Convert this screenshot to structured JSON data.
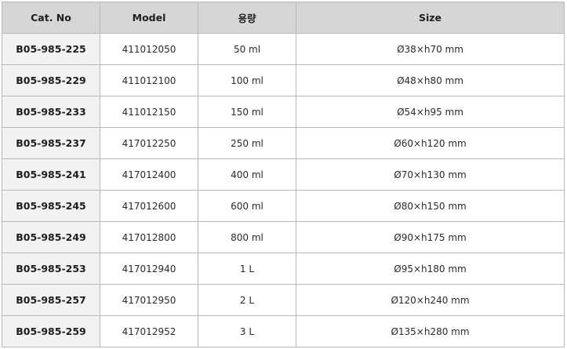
{
  "table": {
    "headers": [
      "Cat. No",
      "Model",
      "용량",
      "Size"
    ],
    "rows": [
      {
        "cat": "B05-985-225",
        "model": "411012050",
        "volume": "50 ml",
        "size": "Ø38×h70 mm"
      },
      {
        "cat": "B05-985-229",
        "model": "411012100",
        "volume": "100 ml",
        "size": "Ø48×h80 mm"
      },
      {
        "cat": "B05-985-233",
        "model": "411012150",
        "volume": "150 ml",
        "size": "Ø54×h95 mm"
      },
      {
        "cat": "B05-985-237",
        "model": "417012250",
        "volume": "250 ml",
        "size": "Ø60×h120 mm"
      },
      {
        "cat": "B05-985-241",
        "model": "417012400",
        "volume": "400 ml",
        "size": "Ø70×h130 mm"
      },
      {
        "cat": "B05-985-245",
        "model": "417012600",
        "volume": "600 ml",
        "size": "Ø80×h150 mm"
      },
      {
        "cat": "B05-985-249",
        "model": "417012800",
        "volume": "800 ml",
        "size": "Ø90×h175 mm"
      },
      {
        "cat": "B05-985-253",
        "model": "417012940",
        "volume": "1 L",
        "size": "Ø95×h180 mm"
      },
      {
        "cat": "B05-985-257",
        "model": "417012950",
        "volume": "2 L",
        "size": "Ø120×h240 mm"
      },
      {
        "cat": "B05-985-259",
        "model": "417012952",
        "volume": "3 L",
        "size": "Ø135×h280 mm"
      }
    ]
  },
  "colors": {
    "header_bg": "#d6d6d6",
    "cat_bg": "#f2f2f2",
    "border": "#b9b9b9"
  }
}
